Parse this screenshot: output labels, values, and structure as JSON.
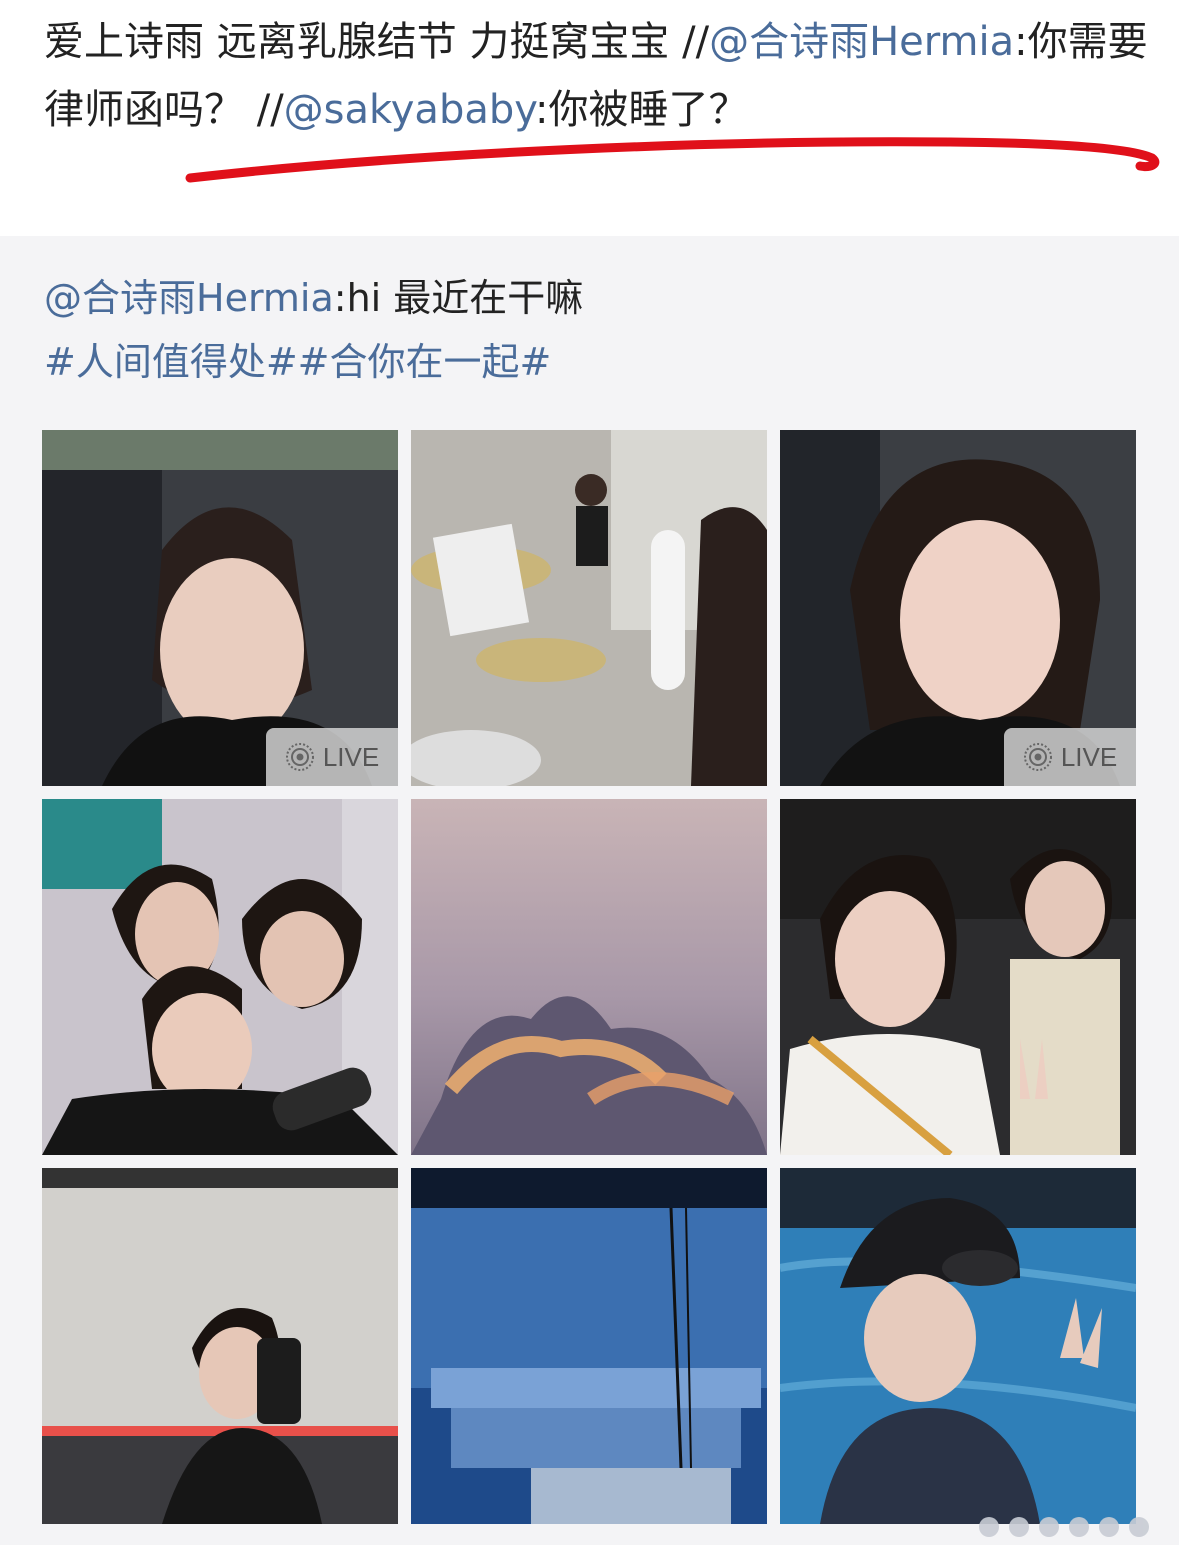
{
  "post": {
    "line1_text": "爱上诗雨 远离乳腺结节 力挺窝宝宝 //",
    "mention1": "@合诗雨Hermia",
    "text2": ":你需要律师函吗？ //",
    "mention2": "@sakyababy",
    "text3": ":你被睡了？"
  },
  "retweet": {
    "mention": "@合诗雨Hermia",
    "body": ":hi 最近在干嘛",
    "topics": "#人间值得处##合你在一起#"
  },
  "images": [
    {
      "label": "selfie in car",
      "live": true
    },
    {
      "label": "drum practice",
      "live": false
    },
    {
      "label": "smiling selfie in car",
      "live": true
    },
    {
      "label": "karaoke with friends",
      "live": false
    },
    {
      "label": "sunset clouds",
      "live": false
    },
    {
      "label": "selfie with friend at night",
      "live": false
    },
    {
      "label": "dance studio mirror selfie",
      "live": false
    },
    {
      "label": "blue stage",
      "live": false
    },
    {
      "label": "swimming pool selfie",
      "live": false
    }
  ],
  "live_badge": "LIVE",
  "annotation_color": "#e0101a",
  "link_color": "#4a6c9a"
}
